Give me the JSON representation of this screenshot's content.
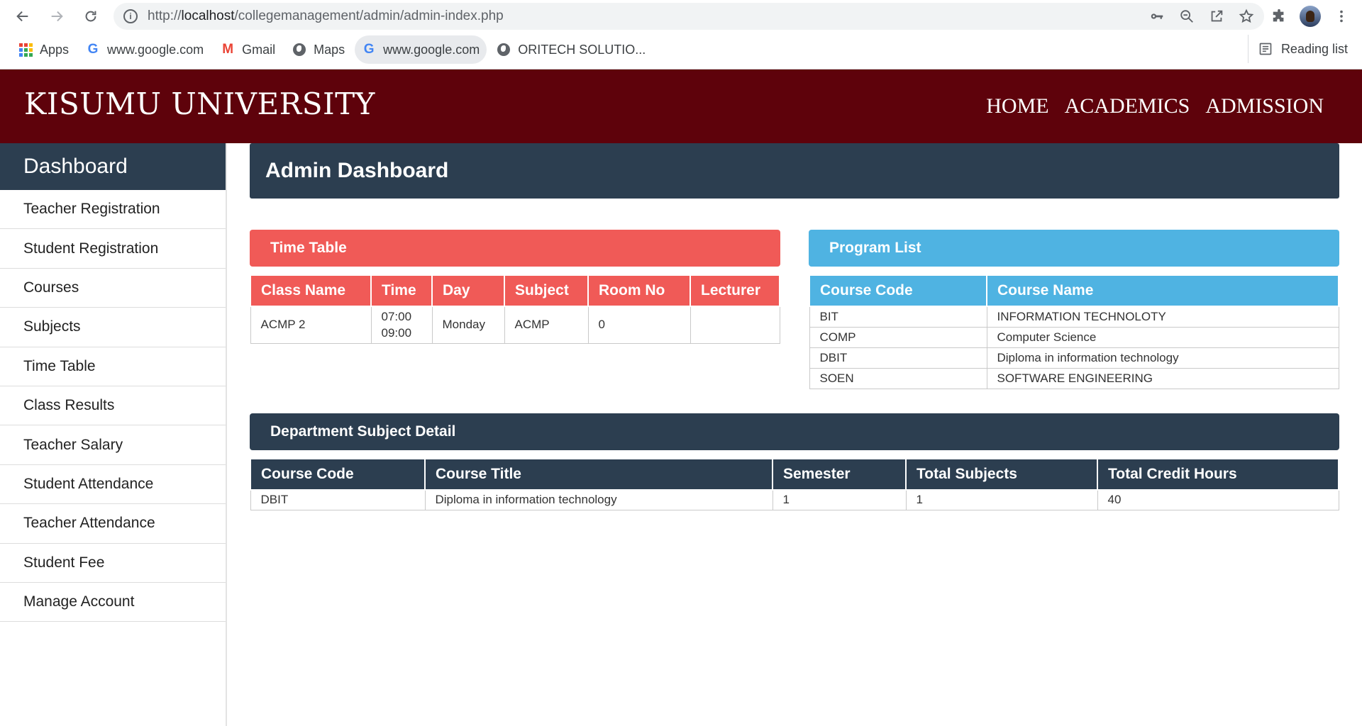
{
  "browser": {
    "url_prefix": "http://",
    "url_host": "localhost",
    "url_path": "/collegemanagement/admin/admin-index.php",
    "bookmarks": [
      {
        "label": "Apps",
        "icon": "apps-icon"
      },
      {
        "label": "www.google.com",
        "icon": "google-icon"
      },
      {
        "label": "Gmail",
        "icon": "gmail-icon"
      },
      {
        "label": "Maps",
        "icon": "globe-icon"
      },
      {
        "label": "www.google.com",
        "icon": "google-icon"
      },
      {
        "label": "ORITECH SOLUTIO...",
        "icon": "globe-icon"
      }
    ],
    "reading_list": "Reading list"
  },
  "header": {
    "title": "KISUMU UNIVERSITY",
    "nav": [
      "HOME",
      "ACADEMICS",
      "ADMISSION"
    ],
    "color": "#5e020b"
  },
  "sidebar": {
    "title": "Dashboard",
    "items": [
      "Teacher Registration",
      "Student Registration",
      "Courses",
      "Subjects",
      "Time Table",
      "Class Results",
      "Teacher Salary",
      "Student Attendance",
      "Teacher Attendance",
      "Student Fee",
      "Manage Account"
    ]
  },
  "main": {
    "page_title": "Admin Dashboard",
    "timetable": {
      "title": "Time Table",
      "columns": [
        "Class Name",
        "Time",
        "Day",
        "Subject",
        "Room No",
        "Lecturer"
      ],
      "rows": [
        {
          "class_name": "ACMP 2",
          "time_start": "07:00",
          "time_end": "09:00",
          "day": "Monday",
          "subject": "ACMP",
          "room": "0",
          "lecturer": ""
        }
      ]
    },
    "programs": {
      "title": "Program List",
      "columns": [
        "Course Code",
        "Course Name"
      ],
      "rows": [
        [
          "BIT",
          "INFORMATION TECHNOLOTY"
        ],
        [
          "COMP",
          "Computer Science"
        ],
        [
          "DBIT",
          "Diploma in information technology"
        ],
        [
          "SOEN",
          "SOFTWARE ENGINEERING"
        ]
      ]
    },
    "department": {
      "title": "Department Subject Detail",
      "columns": [
        "Course Code",
        "Course Title",
        "Semester",
        "Total Subjects",
        "Total Credit Hours"
      ],
      "rows": [
        [
          "DBIT",
          "Diploma in information technology",
          "1",
          "1",
          "40"
        ]
      ]
    }
  },
  "colors": {
    "timetable_accent": "#f05a57",
    "program_accent": "#4fb3e2",
    "dark_accent": "#2c3e50"
  }
}
